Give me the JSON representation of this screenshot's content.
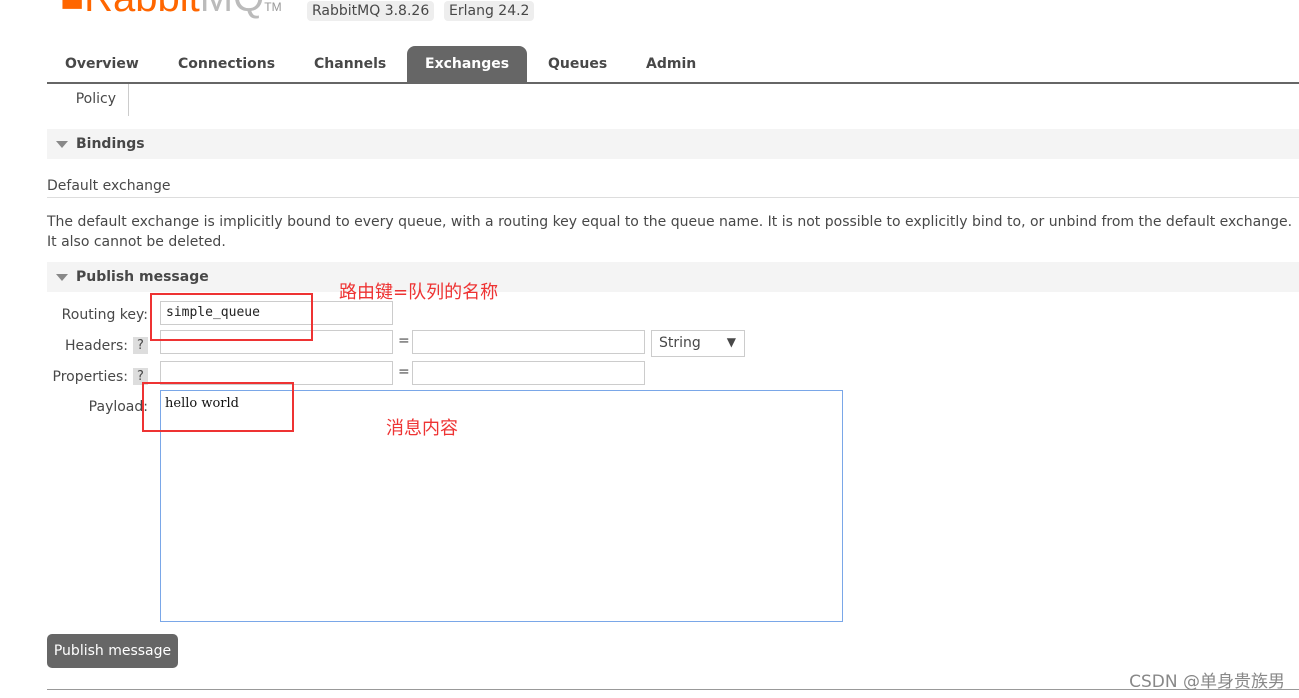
{
  "header": {
    "logo_text": "RabbitMQ",
    "version": "RabbitMQ 3.8.26",
    "erlang": "Erlang 24.2"
  },
  "nav": {
    "tabs": [
      "Overview",
      "Connections",
      "Channels",
      "Exchanges",
      "Queues",
      "Admin"
    ],
    "active": "Exchanges",
    "sub": "Policy"
  },
  "bindings": {
    "title": "Bindings",
    "exchange": "Default exchange",
    "description": "The default exchange is implicitly bound to every queue, with a routing key equal to the queue name. It is not possible to explicitly bind to, or unbind from the default exchange. It also cannot be deleted."
  },
  "publish": {
    "title": "Publish message",
    "routing_key_label": "Routing key:",
    "routing_key": "simple_queue",
    "headers_label": "Headers:",
    "properties_label": "Properties:",
    "help": "?",
    "eq": "=",
    "type_select": "String",
    "payload_label": "Payload:",
    "payload": "hello world",
    "button": "Publish message"
  },
  "annotations": {
    "routing": "路由键=队列的名称",
    "payload": "消息内容"
  },
  "watermark": "CSDN @单身贵族男"
}
